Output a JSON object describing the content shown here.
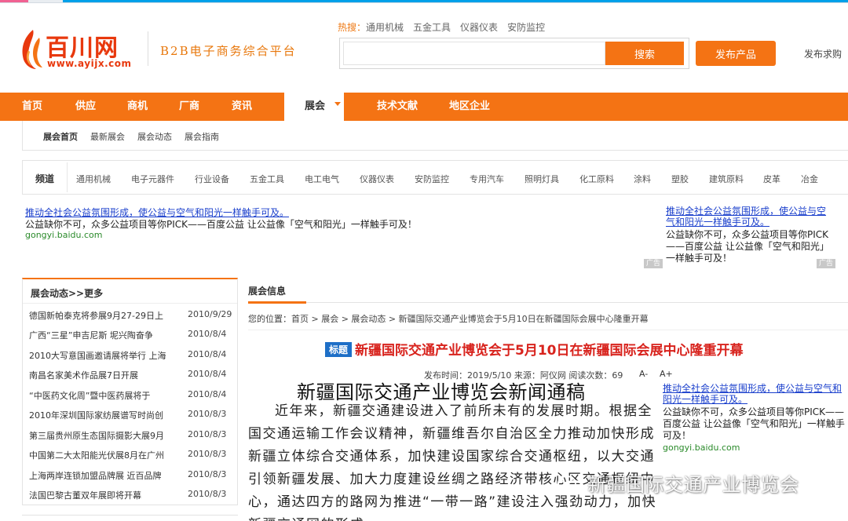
{
  "header": {
    "logo_cn": "百川网",
    "logo_url": "www.ayijx.com",
    "slogan": "B2B电子商务综合平台",
    "hot_label": "热搜：",
    "hot_items": [
      "通用机械",
      "五金工具",
      "仪器仪表",
      "安防监控"
    ],
    "search_placeholder": "",
    "search_button": "搜索",
    "publish_button": "发布产品",
    "buy_link": "发布求购"
  },
  "nav": {
    "items": [
      "首页",
      "供应",
      "商机",
      "厂商",
      "资讯",
      "展会",
      "技术文献",
      "地区企业"
    ],
    "active": "展会"
  },
  "subnav": [
    "展会首页",
    "最新展会",
    "展会动态",
    "展会指南"
  ],
  "channel": {
    "label": "频道",
    "items": [
      "通用机械",
      "电子元器件",
      "行业设备",
      "五金工具",
      "电工电气",
      "仪器仪表",
      "安防监控",
      "专用汽车",
      "照明灯具",
      "化工原料",
      "涂料",
      "塑胶",
      "建筑原料",
      "皮革",
      "冶金"
    ]
  },
  "ads": {
    "link": "推动全社会公益氛围形成，使公益与空气和阳光一样触手可及。",
    "desc": "公益缺你不可，众多公益项目等你PICK——百度公益 让公益像「空气和阳光」一样触手可及！",
    "desc_right": "公益缺你不可，众多公益项目等你PICK——百度公益 让公益像「空气和阳光」一样触手可及！",
    "domain": "gongyi.baidu.com",
    "tag": "广告"
  },
  "sidebar": {
    "title": "展会动态>>更多",
    "news": [
      {
        "title": "德国新帕泰克将参展9月27-29日上",
        "date": "2010/9/29"
      },
      {
        "title": "广西“三星”申吉尼斯 坭兴陶奋争",
        "date": "2010/8/4"
      },
      {
        "title": "2010大写意国画邀请展将举行 上海",
        "date": "2010/8/4"
      },
      {
        "title": "南昌名家美术作品展7日开展",
        "date": "2010/8/4"
      },
      {
        "title": "“中医药文化周”暨中医药展将于",
        "date": "2010/8/4"
      },
      {
        "title": "2010年深圳国际家纺展谱写时尚创",
        "date": "2010/8/3"
      },
      {
        "title": "第三届贵州原生态国际摄影大展9月",
        "date": "2010/8/3"
      },
      {
        "title": "中国第二大太阳能光伏展8月在广州",
        "date": "2010/8/3"
      },
      {
        "title": "上海两岸连锁加盟品牌展 近百品牌",
        "date": "2010/8/3"
      },
      {
        "title": "法国巴黎古董双年展即将开幕",
        "date": "2010/8/3"
      }
    ]
  },
  "main": {
    "section_title": "展会信息",
    "breadcrumb": "您的位置：首页 > 展会 > 展会动态 > 新疆国际交通产业博览会于5月10日在新疆国际会展中心隆重开幕",
    "badge": "标题",
    "title": "新疆国际交通产业博览会于5月10日在新疆国际会展中心隆重开幕",
    "meta": "发布时间：2019/5/10  来源：阿仪网  阅读次数：69",
    "font_larger": "A+",
    "font_smaller": "A-",
    "press_title": "新疆国际交通产业博览会新闻通稿",
    "body": "近年来，新疆交通建设进入了前所未有的发展时期。根据全国交通运输工作会议精神，新疆维吾尔自治区全力推动加快形成新疆立体综合交通体系，加快建设国家综合交通枢纽，以大交通引领新疆发展、加大力度建设丝绸之路经济带核心区交通枢纽中心，通达四方的路网为推进“一带一路”建设注入强劲动力，加快新疆交通网的形成"
  },
  "watermark": "新疆国际交通产业博览会",
  "colors": {
    "accent": "#f47314",
    "brand_red": "#e8380d",
    "title_red": "#d8231d",
    "link_blue": "#1a3fcc"
  }
}
